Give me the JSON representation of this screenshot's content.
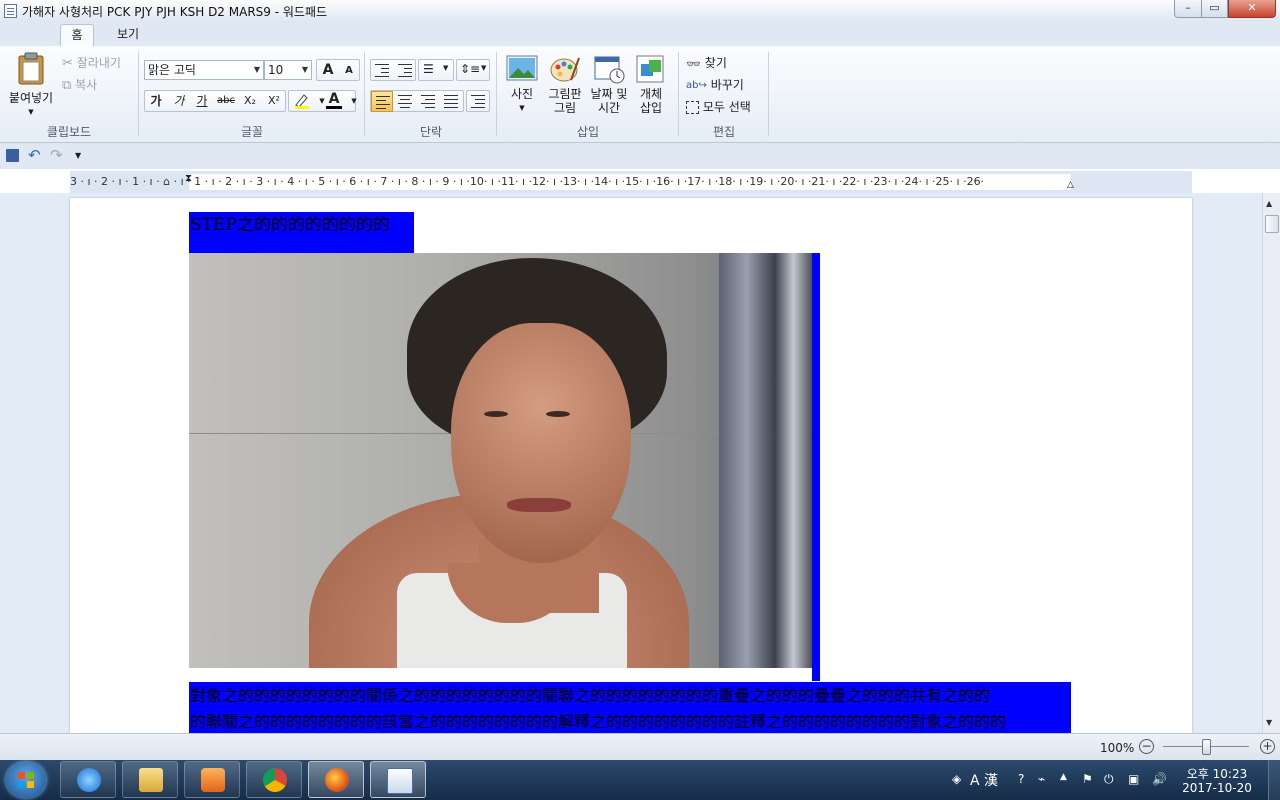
{
  "window": {
    "title": "가해자 사형처리 PCK PJY PJH KSH D2 MARS9 - 워드패드",
    "min_glyph": "–",
    "max_glyph": "▭",
    "close_glyph": "✕"
  },
  "tabs": {
    "home": "홈",
    "view": "보기",
    "help": "?"
  },
  "ribbon": {
    "clipboard": {
      "label": "클립보드",
      "paste": "붙여넣기",
      "cut": "잘라내기",
      "copy": "복사"
    },
    "font": {
      "label": "글꼴",
      "family": "맑은 고딕",
      "size": "10",
      "grow": "A",
      "shrink": "A",
      "bold": "가",
      "italic": "가",
      "underline": "가",
      "strike": "abc",
      "subscript": "X₂",
      "superscript": "X²",
      "color_letter": "A"
    },
    "paragraph": {
      "label": "단락"
    },
    "insert": {
      "label": "삽입",
      "picture": "사진",
      "paint_1": "그림판",
      "paint_2": "그림",
      "datetime_1": "날짜 및",
      "datetime_2": "시간",
      "object_1": "개체",
      "object_2": "삽입"
    },
    "editing": {
      "label": "편집",
      "find": "찾기",
      "replace": "바꾸기",
      "select_all": "모두 선택"
    }
  },
  "ruler": {
    "marks": "3 · ı · 2 · ı · 1 · ı · ⌂ · ı · 1 · ı · 2 · ı · 3 · ı · 4 · ı · 5 · ı · 6 · ı · 7 · ı · 8 · ı · 9 · ı ·10· ı ·11· ı ·12· ı ·13· ı ·14· ı ·15· ı ·16· ı ·17· ı ·18· ı ·19· ı ·20· ı ·21· ı ·22· ı ·23· ı ·24· ı ·25· ı ·26·"
  },
  "document": {
    "line1": "STEP之的的的的的的的的",
    "line2": "對象之的的的的的的的的關係之的的的的的的的的關聯之的的的的的的的的重疊之的的的疊疊之的的的共有之的的",
    "line3": "的聯關之的的的的的的的的該當之的的的的的的的的解釋之的的的的的的的的註釋之的的的的的的的的對象之的的的"
  },
  "status": {
    "zoom": "100%",
    "zoom_out": "−",
    "zoom_in": "+"
  },
  "taskbar": {
    "ime": "A 漢",
    "time": "오후 10:23",
    "date": "2017-10-20"
  },
  "colors": {
    "selection": "#0000ff",
    "ribbon_bg": "#e6edf6",
    "taskbar": "#1d3a5c"
  }
}
